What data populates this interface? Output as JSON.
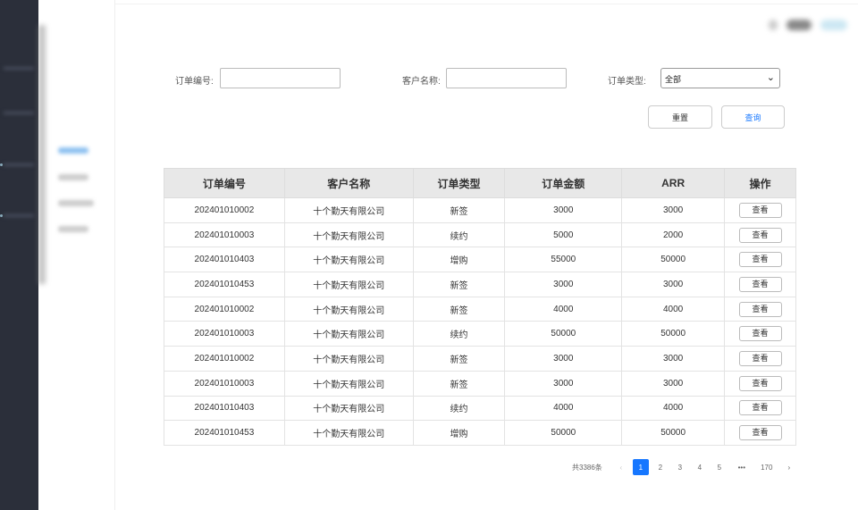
{
  "filters": {
    "order_no_label": "订单编号:",
    "customer_label": "客户名称:",
    "type_label": "订单类型:",
    "order_no_value": "",
    "customer_value": "",
    "type_selected": "全部"
  },
  "buttons": {
    "reset": "重置",
    "search": "查询"
  },
  "table": {
    "headers": [
      "订单编号",
      "客户名称",
      "订单类型",
      "订单金额",
      "ARR",
      "操作"
    ],
    "rows": [
      [
        "202401010002",
        "十个勤天有限公司",
        "新签",
        "3000",
        "3000"
      ],
      [
        "202401010003",
        "十个勤天有限公司",
        "续约",
        "5000",
        "2000"
      ],
      [
        "202401010403",
        "十个勤天有限公司",
        "增购",
        "55000",
        "50000"
      ],
      [
        "202401010453",
        "十个勤天有限公司",
        "新签",
        "3000",
        "3000"
      ],
      [
        "202401010002",
        "十个勤天有限公司",
        "新签",
        "4000",
        "4000"
      ],
      [
        "202401010003",
        "十个勤天有限公司",
        "续约",
        "50000",
        "50000"
      ],
      [
        "202401010002",
        "十个勤天有限公司",
        "新签",
        "3000",
        "3000"
      ],
      [
        "202401010003",
        "十个勤天有限公司",
        "新签",
        "3000",
        "3000"
      ],
      [
        "202401010403",
        "十个勤天有限公司",
        "续约",
        "4000",
        "4000"
      ],
      [
        "202401010453",
        "十个勤天有限公司",
        "增购",
        "50000",
        "50000"
      ]
    ],
    "action_label": "查看"
  },
  "pagination": {
    "total": "共3386条",
    "pages": [
      "1",
      "2",
      "3",
      "4",
      "5",
      "•••",
      "170"
    ],
    "current": "1",
    "prev": "‹",
    "next": "›"
  },
  "colors": {
    "accent": "#1677ff",
    "sidebar": "#2b2f3a"
  }
}
